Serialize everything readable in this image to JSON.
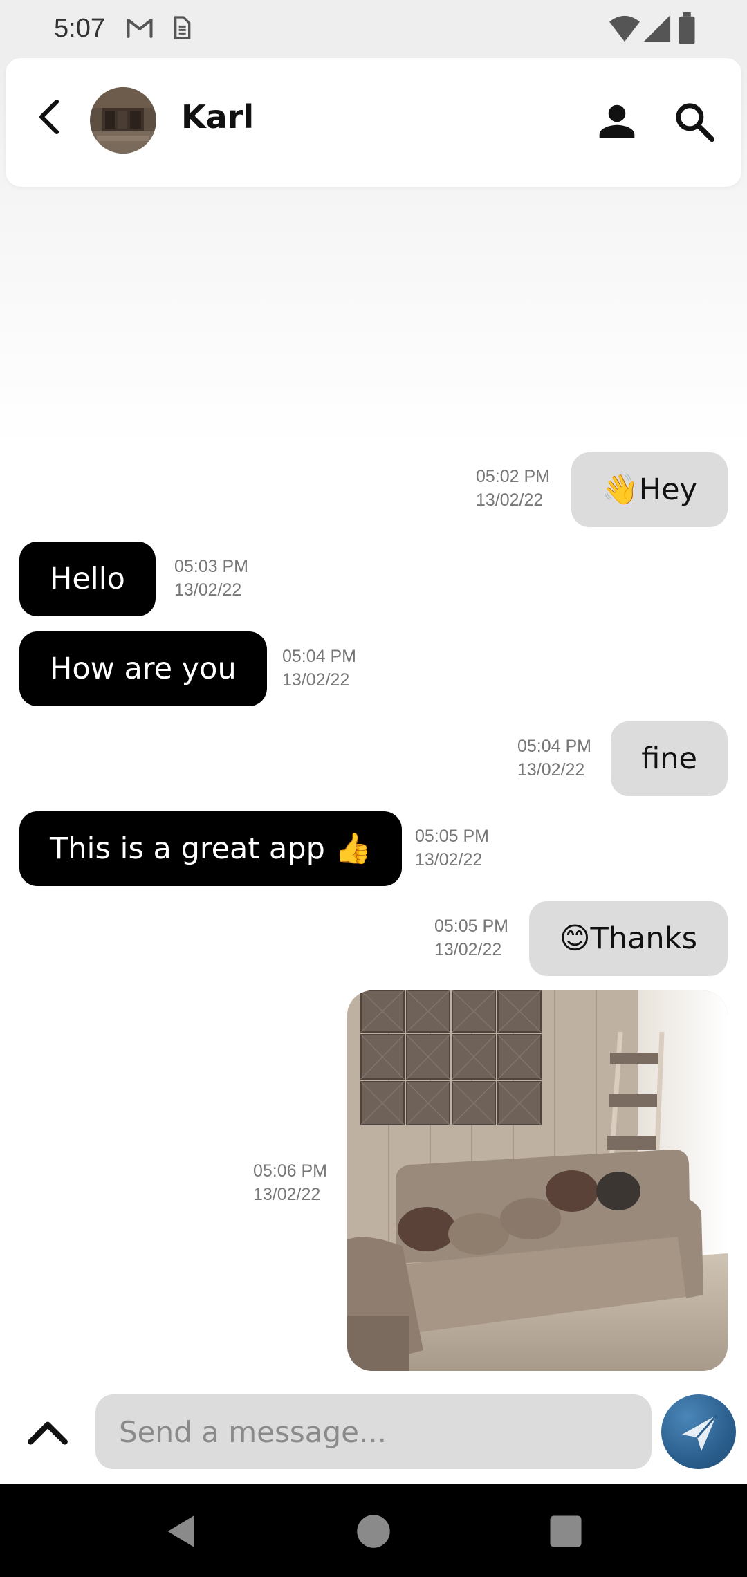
{
  "status_bar": {
    "time": "5:07",
    "icons": [
      "gmail-icon",
      "sim-icon",
      "wifi-icon",
      "signal-icon",
      "battery-icon"
    ]
  },
  "header": {
    "contact_name": "Karl",
    "avatar": "contact-avatar",
    "icons": [
      "back-arrow-icon",
      "person-icon",
      "search-icon"
    ]
  },
  "messages": [
    {
      "direction": "outgoing",
      "text": "👋Hey",
      "time": "05:02 PM",
      "date": "13/02/22"
    },
    {
      "direction": "incoming",
      "text": "Hello",
      "time": "05:03 PM",
      "date": "13/02/22"
    },
    {
      "direction": "incoming",
      "text": "How are you",
      "time": "05:04 PM",
      "date": "13/02/22"
    },
    {
      "direction": "outgoing",
      "text": "fine",
      "time": "05:04 PM",
      "date": "13/02/22"
    },
    {
      "direction": "incoming",
      "text": "This is a great app 👍",
      "time": "05:05 PM",
      "date": "13/02/22"
    },
    {
      "direction": "outgoing",
      "text": "😊Thanks",
      "time": "05:05 PM",
      "date": "13/02/22"
    },
    {
      "direction": "outgoing",
      "type": "image",
      "image": "living-room-sofa-photo",
      "time": "05:06 PM",
      "date": "13/02/22"
    }
  ],
  "composer": {
    "placeholder": "Send a message...",
    "value": "",
    "icons": [
      "chevron-up-icon",
      "send-icon"
    ]
  },
  "nav_bar": {
    "icons": [
      "nav-back-icon",
      "nav-home-icon",
      "nav-recents-icon"
    ]
  },
  "colors": {
    "incoming_bubble": "#000000",
    "outgoing_bubble": "#dcdcdc",
    "send_button": "#2b5f8e",
    "status_bar": "#eeeeee"
  }
}
